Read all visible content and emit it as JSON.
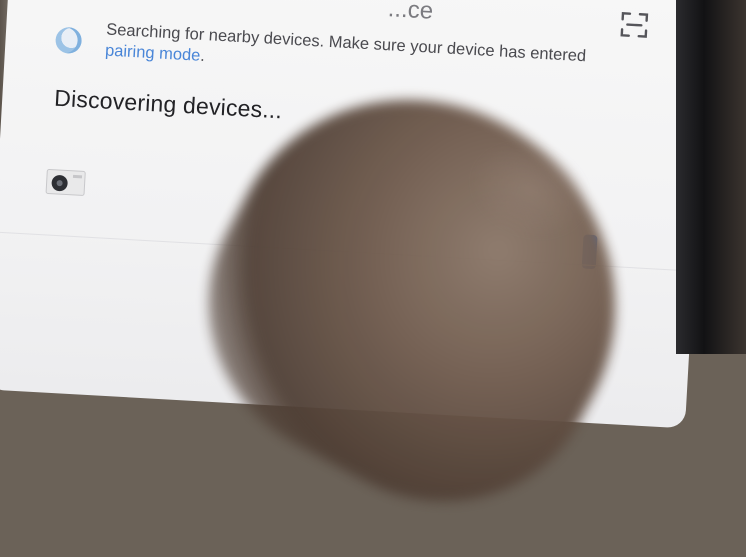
{
  "header": {
    "title_fragment": "...ce",
    "scan_icon": "scan-frame-icon"
  },
  "search": {
    "prefix": "Searching for nearby devices. Make sure your device has entered ",
    "link": "pairing mode",
    "suffix": "."
  },
  "discover": {
    "heading": "Discovering devices..."
  },
  "device": {
    "icon": "air-conditioner-unit-icon"
  },
  "colors": {
    "accent": "#4a86d8",
    "spinner": "#9cc3e6",
    "button": "#3f7fe0"
  }
}
